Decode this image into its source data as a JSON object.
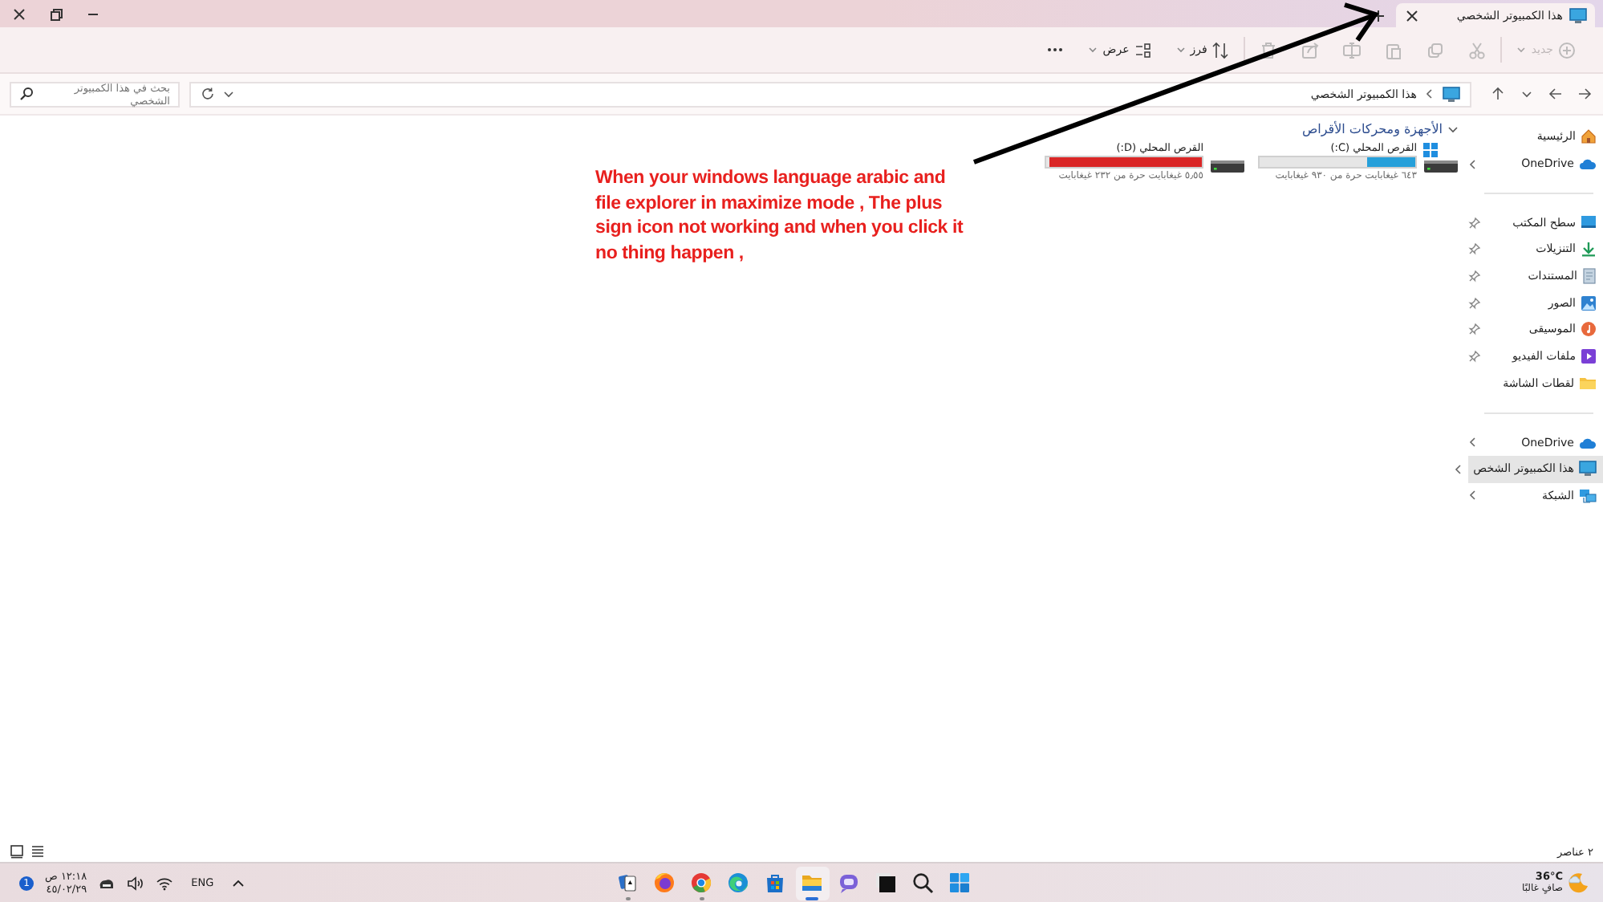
{
  "title_bar": {
    "tabs": [
      {
        "title": "هذا الكمبيوتر الشخصي",
        "selected": true
      }
    ]
  },
  "toolbar": {
    "groups": [
      [
        {
          "kind": "new",
          "label": "جديد",
          "disabled": true
        }
      ],
      [
        {
          "kind": "cut",
          "disabled": true
        },
        {
          "kind": "copy",
          "disabled": true
        },
        {
          "kind": "paste",
          "disabled": true
        },
        {
          "kind": "rename",
          "disabled": true
        },
        {
          "kind": "share",
          "disabled": true
        },
        {
          "kind": "delete",
          "disabled": true
        }
      ],
      [
        {
          "kind": "sort",
          "label": "فرز",
          "disabled": false
        },
        {
          "kind": "view",
          "label": "عرض",
          "disabled": false
        },
        {
          "kind": "more",
          "disabled": false
        }
      ]
    ]
  },
  "address": {
    "location": "هذا الكمبيوتر الشخصي"
  },
  "search": {
    "placeholder": "بحث في هذا الكمبيوتر الشخصي"
  },
  "sidebar": {
    "groups": [
      [
        {
          "label": "الرئيسية",
          "kind": "home",
          "pinned": false,
          "expandable": false,
          "selected": false
        },
        {
          "label": "OneDrive",
          "kind": "cloud",
          "pinned": false,
          "expandable": true,
          "selected": false
        }
      ],
      [
        {
          "label": "سطح المكتب",
          "kind": "desktop",
          "pinned": true,
          "expandable": false,
          "selected": false
        },
        {
          "label": "التنزيلات",
          "kind": "downloads",
          "pinned": true,
          "expandable": false,
          "selected": false
        },
        {
          "label": "المستندات",
          "kind": "documents",
          "pinned": true,
          "expandable": false,
          "selected": false
        },
        {
          "label": "الصور",
          "kind": "pictures",
          "pinned": true,
          "expandable": false,
          "selected": false
        },
        {
          "label": "الموسيقى",
          "kind": "music",
          "pinned": true,
          "expandable": false,
          "selected": false
        },
        {
          "label": "ملفات الفيديو",
          "kind": "videos",
          "pinned": true,
          "expandable": false,
          "selected": false
        },
        {
          "label": "لقطات الشاشة",
          "kind": "folder",
          "pinned": false,
          "expandable": false,
          "selected": false
        }
      ],
      [
        {
          "label": "OneDrive",
          "kind": "cloud",
          "pinned": false,
          "expandable": true,
          "selected": false
        },
        {
          "label": "هذا الكمبيوتر الشخص",
          "kind": "pc",
          "pinned": false,
          "expandable": true,
          "selected": true
        },
        {
          "label": "الشبكة",
          "kind": "network",
          "pinned": false,
          "expandable": true,
          "selected": false
        }
      ]
    ]
  },
  "content": {
    "section": {
      "title": "الأجهزة ومحركات الأقراص",
      "expanded": true
    },
    "drives": [
      {
        "name": "القرص المحلي (C:)",
        "kind": "system",
        "level": 0.31,
        "color": "#26a0da",
        "free": "٦٤٣ غيغابايت حرة من ٩٣٠ غيغابايت"
      },
      {
        "name": "القرص المحلي (D:)",
        "kind": "data",
        "level": 0.976,
        "color": "#da2626",
        "free": "٥٫٥٥ غيغابايت حرة من ٢٣٢ غيغابايت"
      }
    ]
  },
  "annotation": {
    "text": "When your windows language arabic and file explorer in maximize mode , The plus sign icon not working and when you click it no thing happen ,"
  },
  "status_bar": {
    "item_count": "٢ عناصر"
  },
  "taskbar": {
    "weather": {
      "temperature": "36°C",
      "condition": "صافٍ غالبًا"
    },
    "apps": [
      {
        "kind": "start",
        "running": false,
        "selected": false
      },
      {
        "kind": "search",
        "running": false,
        "selected": false
      },
      {
        "kind": "terminal",
        "running": false,
        "selected": false
      },
      {
        "kind": "chat",
        "running": false,
        "selected": false
      },
      {
        "kind": "explorer",
        "running": true,
        "selected": true
      },
      {
        "kind": "store",
        "running": false,
        "selected": false
      },
      {
        "kind": "edge",
        "running": false,
        "selected": false
      },
      {
        "kind": "chrome",
        "running": true,
        "selected": false
      },
      {
        "kind": "firefox",
        "running": false,
        "selected": false
      },
      {
        "kind": "cards",
        "running": true,
        "selected": false
      }
    ],
    "tray": {
      "language": "ENG",
      "time": "١٢:١٨ ص",
      "date": "٤٥/٠٢/٢٩",
      "notifications": "1"
    }
  }
}
